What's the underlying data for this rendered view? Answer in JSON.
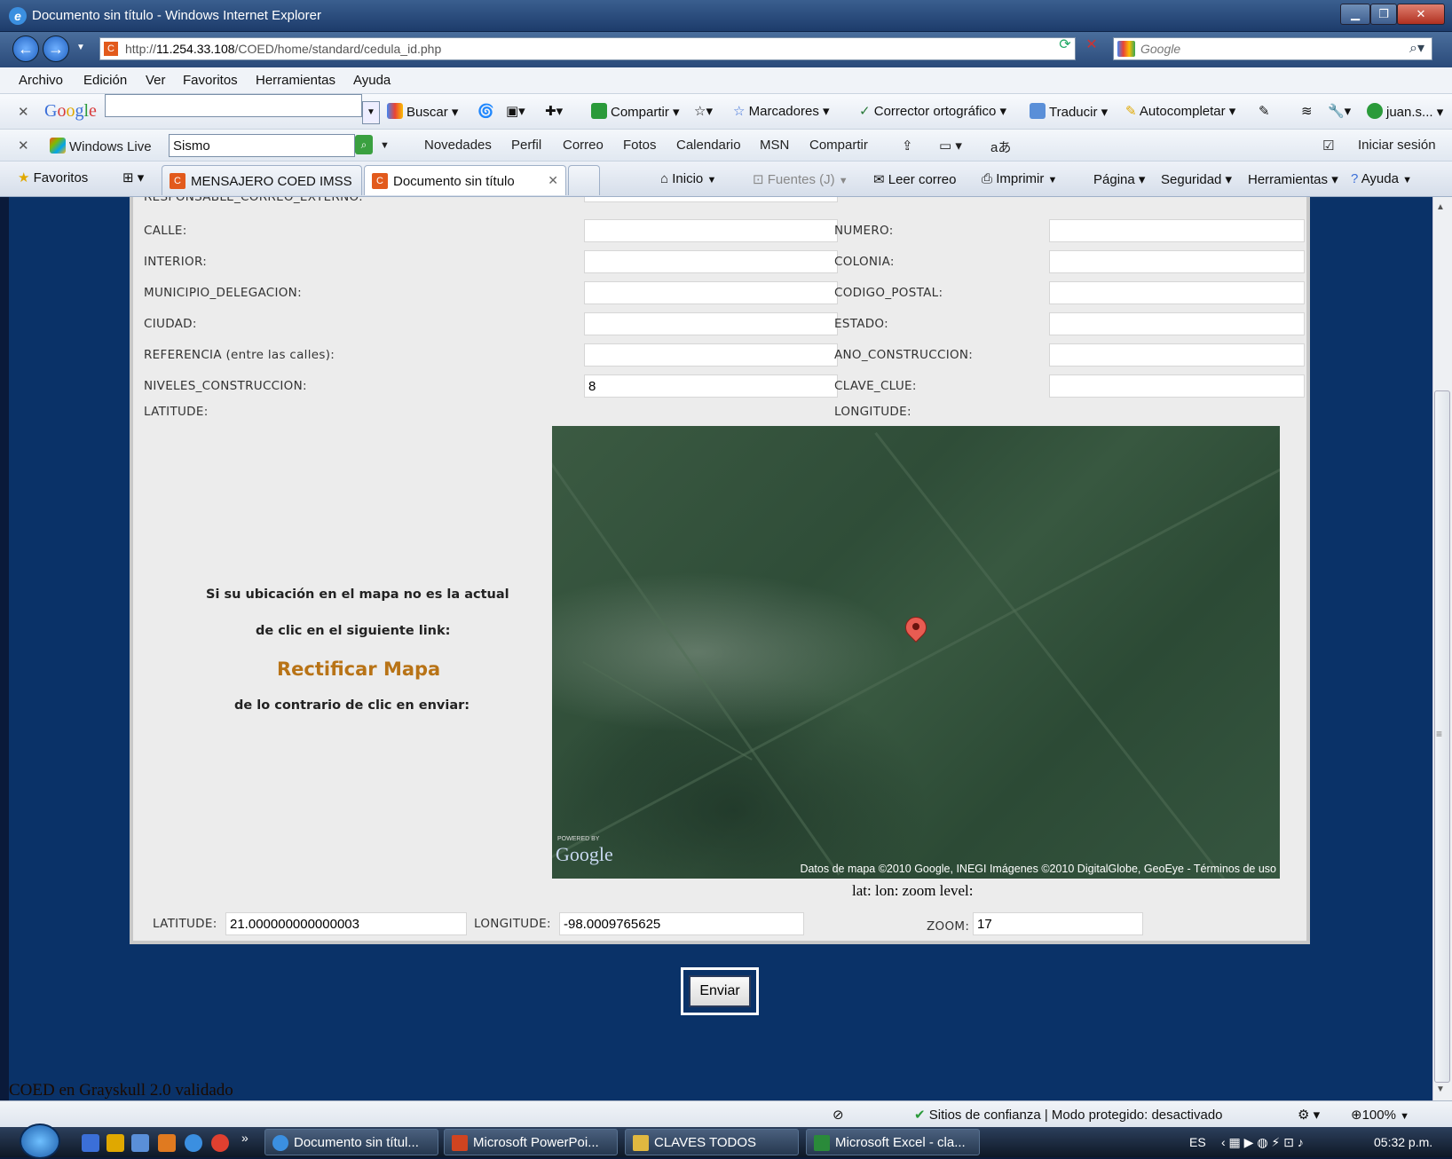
{
  "window": {
    "title": "Documento sin título - Windows Internet Explorer",
    "url_prefix": "http://",
    "url_host": "11.254.33.108",
    "url_path": "/COED/home/standard/cedula_id.php",
    "search_placeholder": "Google"
  },
  "menu": [
    "Archivo",
    "Edición",
    "Ver",
    "Favoritos",
    "Herramientas",
    "Ayuda"
  ],
  "google_toolbar": {
    "logo": "Google",
    "buscar": "Buscar ▾",
    "compartir": "Compartir ▾",
    "marcadores": "Marcadores ▾",
    "corrector": "Corrector ortográfico ▾",
    "traducir": "Traducir ▾",
    "autocompletar": "Autocompletar ▾",
    "user": "juan.s... ▾"
  },
  "wl_toolbar": {
    "brand": "Windows Live",
    "search_value": "Sismo",
    "items": [
      "Novedades",
      "Perfil",
      "Correo",
      "Fotos",
      "Calendario",
      "MSN",
      "Compartir"
    ],
    "signin": "Iniciar sesión"
  },
  "favbar": {
    "favoritos": "Favoritos",
    "tab1": "MENSAJERO COED IMSS",
    "tab2": "Documento sin título",
    "inicio": "Inicio",
    "fuentes": "Fuentes (J)",
    "leer_correo": "Leer correo",
    "imprimir": "Imprimir",
    "pagina": "Página ▾",
    "seguridad": "Seguridad ▾",
    "herramientas": "Herramientas ▾",
    "ayuda": "Ayuda"
  },
  "form": {
    "cut_label": "RESPONSABLE_CORREO_EXTERNO:",
    "calle": "CALLE:",
    "numero": "NUMERO:",
    "interior": "INTERIOR:",
    "colonia": "COLONIA:",
    "municipio": "MUNICIPIO_DELEGACION:",
    "codigo_postal": "CODIGO_POSTAL:",
    "ciudad": "CIUDAD:",
    "estado": "ESTADO:",
    "referencia": "REFERENCIA (entre las calles):",
    "ano_construccion": "ANO_CONSTRUCCION:",
    "niveles": "NIVELES_CONSTRUCCION:",
    "niveles_value": "8",
    "clave_clue": "CLAVE_CLUE:",
    "latitude": "LATITUDE:",
    "longitude": "LONGITUDE:",
    "msg1": "Si su ubicación en el mapa no es la actual",
    "msg2": "de clic en el siguiente link:",
    "link": "Rectificar Mapa",
    "msg3": "de lo contrario de clic en enviar:",
    "map_attrib": "Datos de mapa ©2010 Google, INEGI  Imágenes ©2010 DigitalGlobe, GeoEye - Términos de uso",
    "map_logo": "Google",
    "map_powered": "POWERED BY",
    "zoom_caption": "lat: lon: zoom level:",
    "lat_label": "LATITUDE:",
    "lat_value": "21.000000000000003",
    "lon_label": "LONGITUDE:",
    "lon_value": "-98.0009765625",
    "zoom_label": "ZOOM:",
    "zoom_value": "17",
    "submit": "Enviar"
  },
  "footer": "COED en Grayskull 2.0 validado",
  "status": {
    "zone": "Sitios de confianza | Modo protegido: desactivado",
    "zoom": "100%"
  },
  "taskbar": {
    "t1": "Documento sin títul...",
    "t2": "Microsoft PowerPoi...",
    "t3": "CLAVES TODOS",
    "t4": "Microsoft Excel - cla...",
    "lang": "ES",
    "time": "05:32 p.m."
  }
}
